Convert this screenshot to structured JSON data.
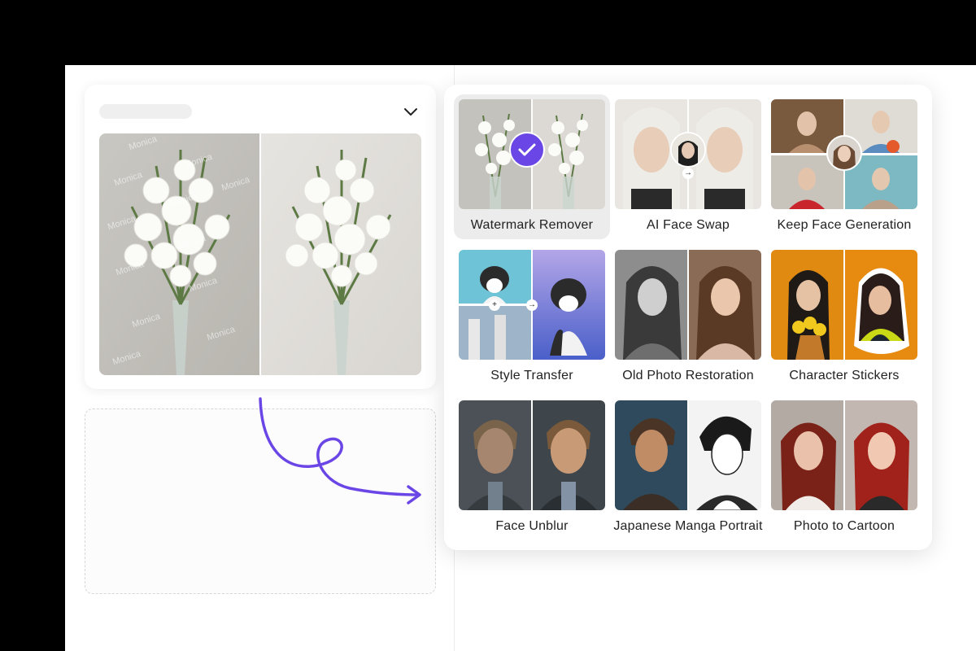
{
  "watermark_text": "Monica",
  "colors": {
    "accent": "#6b46e6",
    "selected_bg": "#ececec"
  },
  "tools": [
    {
      "label": "Watermark Remover",
      "selected": true
    },
    {
      "label": "AI Face Swap",
      "selected": false
    },
    {
      "label": "Keep Face Generation",
      "selected": false
    },
    {
      "label": "Style Transfer",
      "selected": false
    },
    {
      "label": "Old Photo Restoration",
      "selected": false
    },
    {
      "label": "Character Stickers",
      "selected": false
    },
    {
      "label": "Face Unblur",
      "selected": false
    },
    {
      "label": "Japanese Manga Portrait",
      "selected": false
    },
    {
      "label": "Photo to Cartoon",
      "selected": false
    }
  ],
  "icons": {
    "dropdown": "chevron-down-icon",
    "selected": "checkmark-icon",
    "flow": "curly-arrow-icon"
  }
}
